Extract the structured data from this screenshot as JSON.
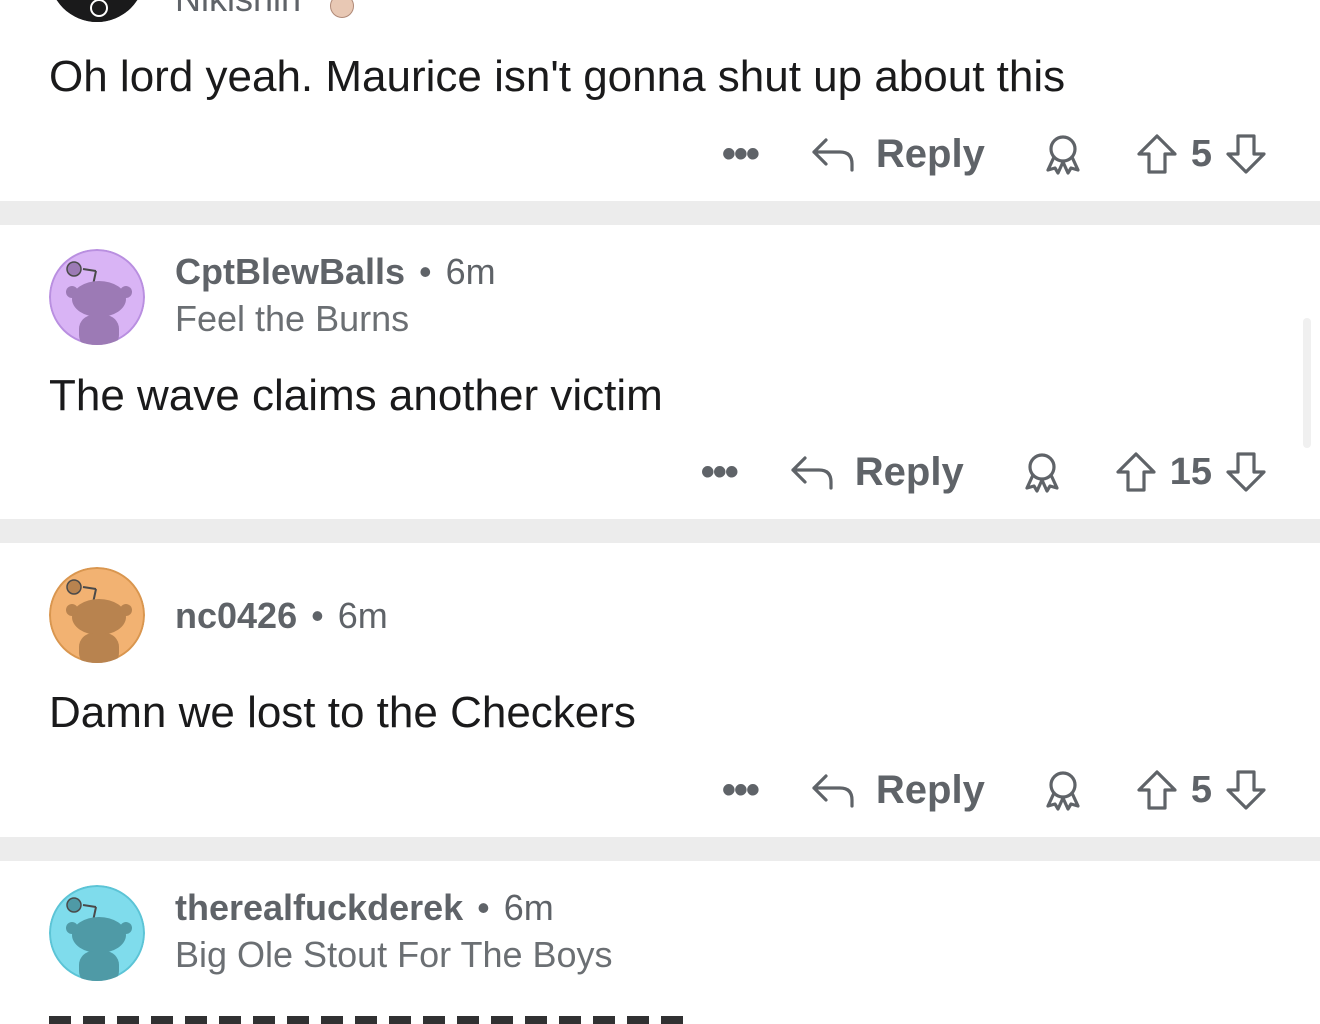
{
  "comments": [
    {
      "username": "Nikishin",
      "body": "Oh lord yeah. Maurice isn't gonna shut up about this",
      "more": "•••",
      "reply_label": "Reply",
      "score": "5",
      "avatar_color": "#1a1a1b"
    },
    {
      "username": "CptBlewBalls",
      "separator": "•",
      "time": "6m",
      "flair": "Feel the Burns",
      "body": "The wave claims another victim",
      "more": "•••",
      "reply_label": "Reply",
      "score": "15",
      "avatar_color": "#d9b4f5"
    },
    {
      "username": "nc0426",
      "separator": "•",
      "time": "6m",
      "body": "Damn we lost to the Checkers",
      "more": "•••",
      "reply_label": "Reply",
      "score": "5",
      "avatar_color": "#f2b272"
    },
    {
      "username": "therealfuckderek",
      "separator": "•",
      "time": "6m",
      "flair": "Big Ole Stout For The Boys",
      "avatar_color": "#7fdcec"
    }
  ],
  "icons": {
    "more": "more-options-icon",
    "reply": "reply-arrow-icon",
    "award": "award-icon",
    "upvote": "upvote-arrow-icon",
    "downvote": "downvote-arrow-icon"
  }
}
